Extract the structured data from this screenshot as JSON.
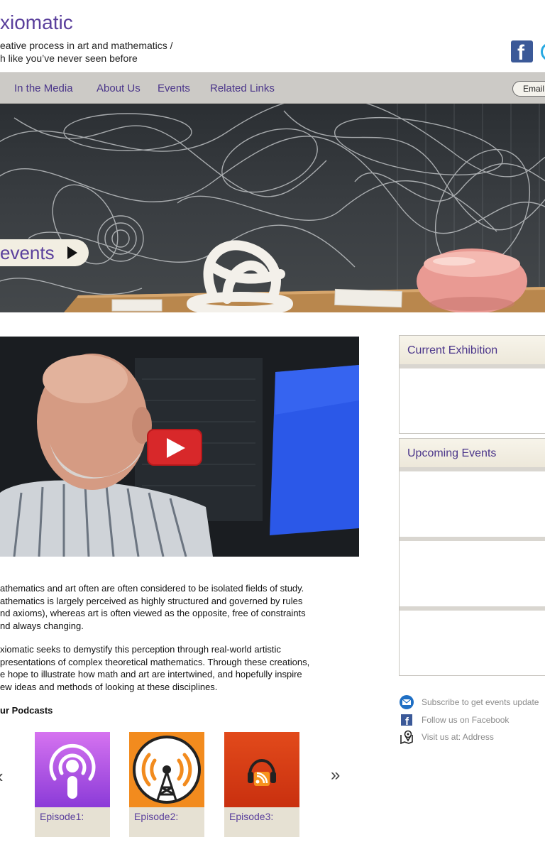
{
  "header": {
    "title": "xiomatic",
    "tagline_line1": "eative process in art and mathematics /",
    "tagline_line2": "h like you’ve never seen before"
  },
  "nav": {
    "items": [
      "In the Media",
      "About Us",
      "Events",
      "Related Links"
    ],
    "email_label": "Email"
  },
  "hero": {
    "events_label": "events"
  },
  "main": {
    "paragraph1": [
      "athematics and art often are often considered to be isolated fields of study.",
      "athematics is largely perceived as highly structured and governed by rules",
      "nd axioms), whereas art is often viewed as the opposite, free of constraints",
      "nd always changing."
    ],
    "paragraph2": [
      "xiomatic seeks to demystify this perception through real-world artistic",
      "presentations of complex theoretical mathematics. Through these creations,",
      "e hope to illustrate how math and art are intertwined, and hopefully inspire",
      "ew ideas and methods of looking at these disciplines."
    ],
    "podcasts_heading": "ur Podcasts",
    "carousel": {
      "prev": "‹",
      "next": "»"
    },
    "episodes": [
      "Episode1:",
      "Episode2:",
      "Episode3:"
    ]
  },
  "sidebar": {
    "current_exhibition": "Current Exhibition",
    "upcoming_events": "Upcoming Events",
    "contact": [
      {
        "icon": "email-icon",
        "text": "Subscribe to get events update"
      },
      {
        "icon": "facebook-icon",
        "text": "Follow us on Facebook"
      },
      {
        "icon": "map-pin-icon",
        "text": "Visit us at: Address"
      }
    ]
  },
  "colors": {
    "brand_purple": "#5a3f9c",
    "nav_bg": "#cccac6",
    "panel_head_bg": "#efebdf",
    "facebook_blue": "#3b5998",
    "youtube_red": "#d8282a"
  }
}
